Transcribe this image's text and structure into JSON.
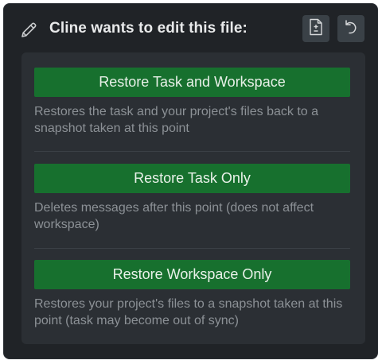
{
  "header": {
    "title": "Cline wants to edit this file:",
    "edit_icon": "pencil-icon",
    "diff_icon": "file-diff-icon",
    "restore_icon": "undo-arrow-icon"
  },
  "options": [
    {
      "button_label": "Restore Task and Workspace",
      "description": "Restores the task and your project's files back to a snapshot taken at this point"
    },
    {
      "button_label": "Restore Task Only",
      "description": "Deletes messages after this point (does not affect workspace)"
    },
    {
      "button_label": "Restore Workspace Only",
      "description": "Restores your project's files to a snapshot taken at this point (task may become out of sync)"
    }
  ],
  "colors": {
    "background": "#202327",
    "popover": "#2b2f34",
    "button": "#17702e",
    "description_text": "#8c9196"
  }
}
